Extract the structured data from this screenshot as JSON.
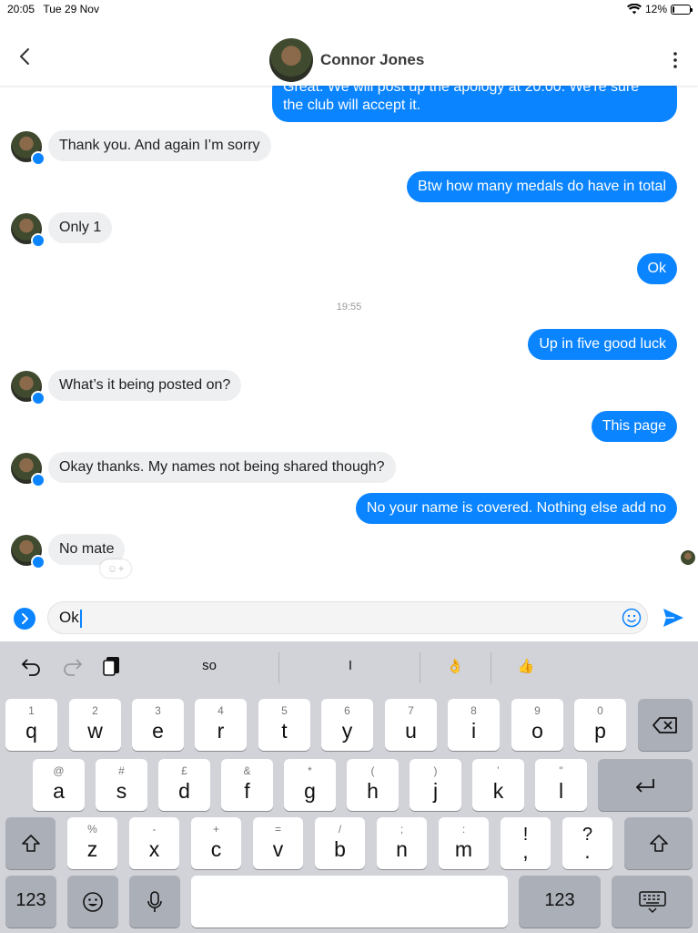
{
  "status_bar": {
    "time": "20:05",
    "date": "Tue 29 Nov",
    "battery": "12%"
  },
  "header": {
    "name": "Connor Jones"
  },
  "messages": [
    {
      "dir": "out",
      "text_line1": "Great. We will post up the apology at 20:00. We're sure",
      "text_line2": "the club will accept it."
    },
    {
      "dir": "in",
      "text": "Thank you. And again I’m sorry"
    },
    {
      "dir": "out",
      "text": "Btw how many medals do have in total"
    },
    {
      "dir": "in",
      "text": "Only 1"
    },
    {
      "dir": "out",
      "text": "Ok"
    },
    {
      "dir": "out",
      "text": "Up in five good luck"
    },
    {
      "dir": "in",
      "text": "What’s it being posted on?"
    },
    {
      "dir": "out",
      "text": "This page"
    },
    {
      "dir": "in",
      "text": "Okay thanks. My names not being shared though?"
    },
    {
      "dir": "out",
      "text": "No your name is covered. Nothing else add no"
    },
    {
      "dir": "in",
      "text": "No mate"
    }
  ],
  "timestamp": "19:55",
  "composer": {
    "value": "Ok"
  },
  "keyboard": {
    "suggestions": [
      "so",
      "I",
      "👌",
      "👍"
    ],
    "row1": [
      [
        "1",
        "q"
      ],
      [
        "2",
        "w"
      ],
      [
        "3",
        "e"
      ],
      [
        "4",
        "r"
      ],
      [
        "5",
        "t"
      ],
      [
        "6",
        "y"
      ],
      [
        "7",
        "u"
      ],
      [
        "8",
        "i"
      ],
      [
        "9",
        "o"
      ],
      [
        "0",
        "p"
      ]
    ],
    "row2": [
      [
        "@",
        "a"
      ],
      [
        "#",
        "s"
      ],
      [
        "£",
        "d"
      ],
      [
        "&",
        "f"
      ],
      [
        "*",
        "g"
      ],
      [
        "(",
        "h"
      ],
      [
        ")",
        "j"
      ],
      [
        "’",
        "k"
      ],
      [
        "\"",
        "l"
      ]
    ],
    "row3": [
      [
        "%",
        "z"
      ],
      [
        "-",
        "x"
      ],
      [
        "+",
        "c"
      ],
      [
        "=",
        "v"
      ],
      [
        "/",
        "b"
      ],
      [
        ";",
        "n"
      ],
      [
        ":",
        "m"
      ],
      [
        "!",
        ","
      ],
      [
        "?",
        "."
      ]
    ],
    "numbers_label": "123"
  },
  "colors": {
    "accent": "#0a84ff",
    "incoming_bubble": "#eeeff1",
    "keyboard_bg": "#d1d3d9"
  }
}
